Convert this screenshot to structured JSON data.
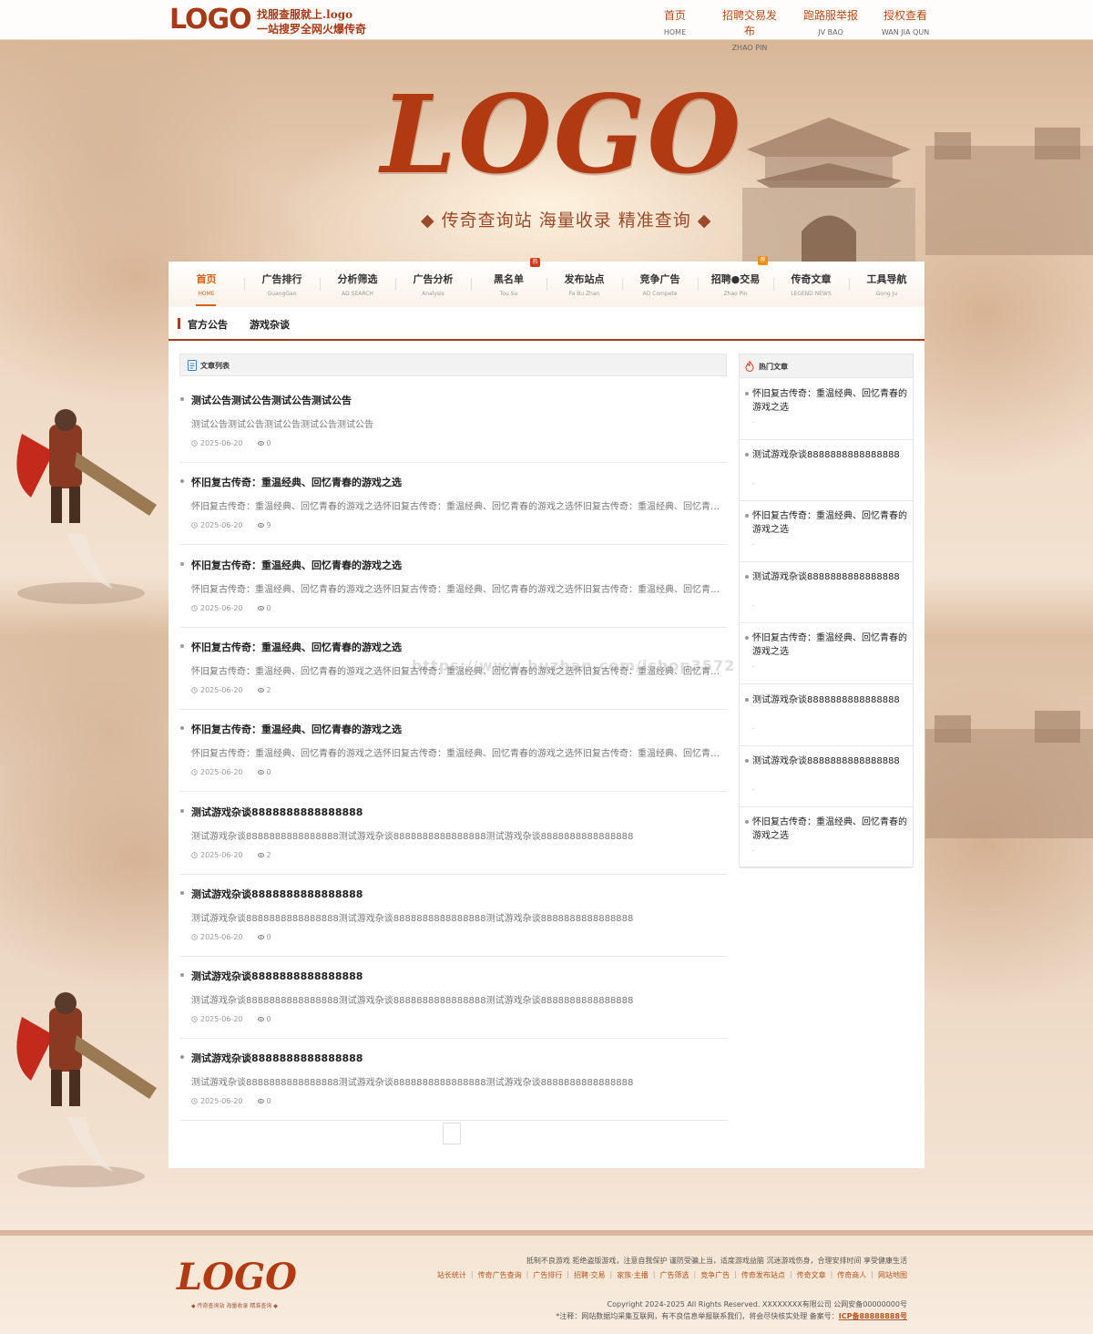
{
  "topbar": {
    "logo": "LOGO",
    "slogan_line1": "找服查服就上.logo",
    "slogan_line2": "一站搜罗全网火爆传奇",
    "nav": [
      {
        "zh": "首页",
        "en": "HOME"
      },
      {
        "zh": "招聘交易发布",
        "en": "ZHAO PIN"
      },
      {
        "zh": "跑路服举报",
        "en": "JV BAO"
      },
      {
        "zh": "授权查看",
        "en": "WAN JIA QUN"
      }
    ]
  },
  "hero": {
    "logo": "LOGO",
    "tagline": "◆ 传奇查询站  海量收录  精准查询 ◆"
  },
  "main_nav": [
    {
      "zh": "首页",
      "en": "HOME",
      "active": true
    },
    {
      "zh": "广告排行",
      "en": "GuangGao"
    },
    {
      "zh": "分析筛选",
      "en": "AD SEARCH"
    },
    {
      "zh": "广告分析",
      "en": "Analysis"
    },
    {
      "zh": "黑名单",
      "en": "Tou Su",
      "badge": "热"
    },
    {
      "zh": "发布站点",
      "en": "Fa Bu Zhan"
    },
    {
      "zh": "竞争广告",
      "en": "AD Compete"
    },
    {
      "zh": "招聘●交易",
      "en": "Zhao Pin",
      "badge": "荐"
    },
    {
      "zh": "传奇文章",
      "en": "LEGEND NEWS"
    },
    {
      "zh": "工具导航",
      "en": "Gong Ju"
    }
  ],
  "subtabs": [
    "官方公告",
    "游戏杂谈"
  ],
  "article_list": {
    "heading": "文章列表",
    "items": [
      {
        "title": "测试公告测试公告测试公告测试公告",
        "desc": "测试公告测试公告测试公告测试公告测试公告",
        "date": "2025-06-20",
        "views": "0"
      },
      {
        "title": "怀旧复古传奇：重温经典、回忆青春的游戏之选",
        "desc": "怀旧复古传奇：重温经典、回忆青春的游戏之选怀旧复古传奇：重温经典、回忆青春的游戏之选怀旧复古传奇：重温经典、回忆青春的游戏之选",
        "date": "2025-06-20",
        "views": "9"
      },
      {
        "title": "怀旧复古传奇：重温经典、回忆青春的游戏之选",
        "desc": "怀旧复古传奇：重温经典、回忆青春的游戏之选怀旧复古传奇：重温经典、回忆青春的游戏之选怀旧复古传奇：重温经典、回忆青春的游戏之选",
        "date": "2025-06-20",
        "views": "0"
      },
      {
        "title": "怀旧复古传奇：重温经典、回忆青春的游戏之选",
        "desc": "怀旧复古传奇：重温经典、回忆青春的游戏之选怀旧复古传奇：重温经典、回忆青春的游戏之选怀旧复古传奇：重温经典、回忆青春的游戏之选",
        "date": "2025-06-20",
        "views": "2"
      },
      {
        "title": "怀旧复古传奇：重温经典、回忆青春的游戏之选",
        "desc": "怀旧复古传奇：重温经典、回忆青春的游戏之选怀旧复古传奇：重温经典、回忆青春的游戏之选怀旧复古传奇：重温经典、回忆青春的游戏之选",
        "date": "2025-06-20",
        "views": "0"
      },
      {
        "title": "测试游戏杂谈8888888888888888",
        "desc": "测试游戏杂谈8888888888888888测试游戏杂谈8888888888888888测试游戏杂谈8888888888888888",
        "date": "2025-06-20",
        "views": "2"
      },
      {
        "title": "测试游戏杂谈8888888888888888",
        "desc": "测试游戏杂谈8888888888888888测试游戏杂谈8888888888888888测试游戏杂谈8888888888888888",
        "date": "2025-06-20",
        "views": "0"
      },
      {
        "title": "测试游戏杂谈8888888888888888",
        "desc": "测试游戏杂谈8888888888888888测试游戏杂谈8888888888888888测试游戏杂谈8888888888888888",
        "date": "2025-06-20",
        "views": "0"
      },
      {
        "title": "测试游戏杂谈8888888888888888",
        "desc": "测试游戏杂谈8888888888888888测试游戏杂谈8888888888888888测试游戏杂谈8888888888888888",
        "date": "2025-06-20",
        "views": "0"
      }
    ]
  },
  "hot": {
    "heading": "热门文章",
    "items": [
      {
        "title": "怀旧复古传奇：重温经典、回忆青春的游戏之选",
        "meta": "-"
      },
      {
        "title": "测试游戏杂谈8888888888888888",
        "meta": "-"
      },
      {
        "title": "怀旧复古传奇：重温经典、回忆青春的游戏之选",
        "meta": "-"
      },
      {
        "title": "测试游戏杂谈8888888888888888",
        "meta": "-"
      },
      {
        "title": "怀旧复古传奇：重温经典、回忆青春的游戏之选",
        "meta": "-"
      },
      {
        "title": "测试游戏杂谈8888888888888888",
        "meta": "-"
      },
      {
        "title": "测试游戏杂谈8888888888888888",
        "meta": "-"
      },
      {
        "title": "怀旧复古传奇：重温经典、回忆青春的游戏之选",
        "meta": "-"
      }
    ]
  },
  "watermark": "https://www.huzhan.com/ishop3572",
  "footer": {
    "logo": "LOGO",
    "tagline": "◆ 传奇查询站  海量收录  精准查询 ◆",
    "notice": "抵制不良游戏 拒绝盗版游戏，注意自我保护 谨防受骗上当，适度游戏益脑 沉迷游戏伤身，合理安排时间 享受健康生活",
    "links": [
      "站长统计",
      "传奇广告查询",
      "广告排行",
      "招聘·交易",
      "家族·主播",
      "广告筛选",
      "竞争广告",
      "传奇发布站点",
      "传奇文章",
      "传奇商人",
      "网站地图"
    ],
    "copyright": "Copyright 2024-2025 All Rights Reserved. XXXXXXXX有限公司 公网安备00000000号",
    "note": "*注释：网站数据均采集互联网，有不良信息举报联系我们，将会尽快核实处理 备案号：",
    "icp": "ICP备88888888号"
  },
  "colors": {
    "brand": "#b23a12",
    "accent": "#d2601a",
    "badge_hot": "#d23a1a",
    "badge_rec": "#e8901a"
  }
}
